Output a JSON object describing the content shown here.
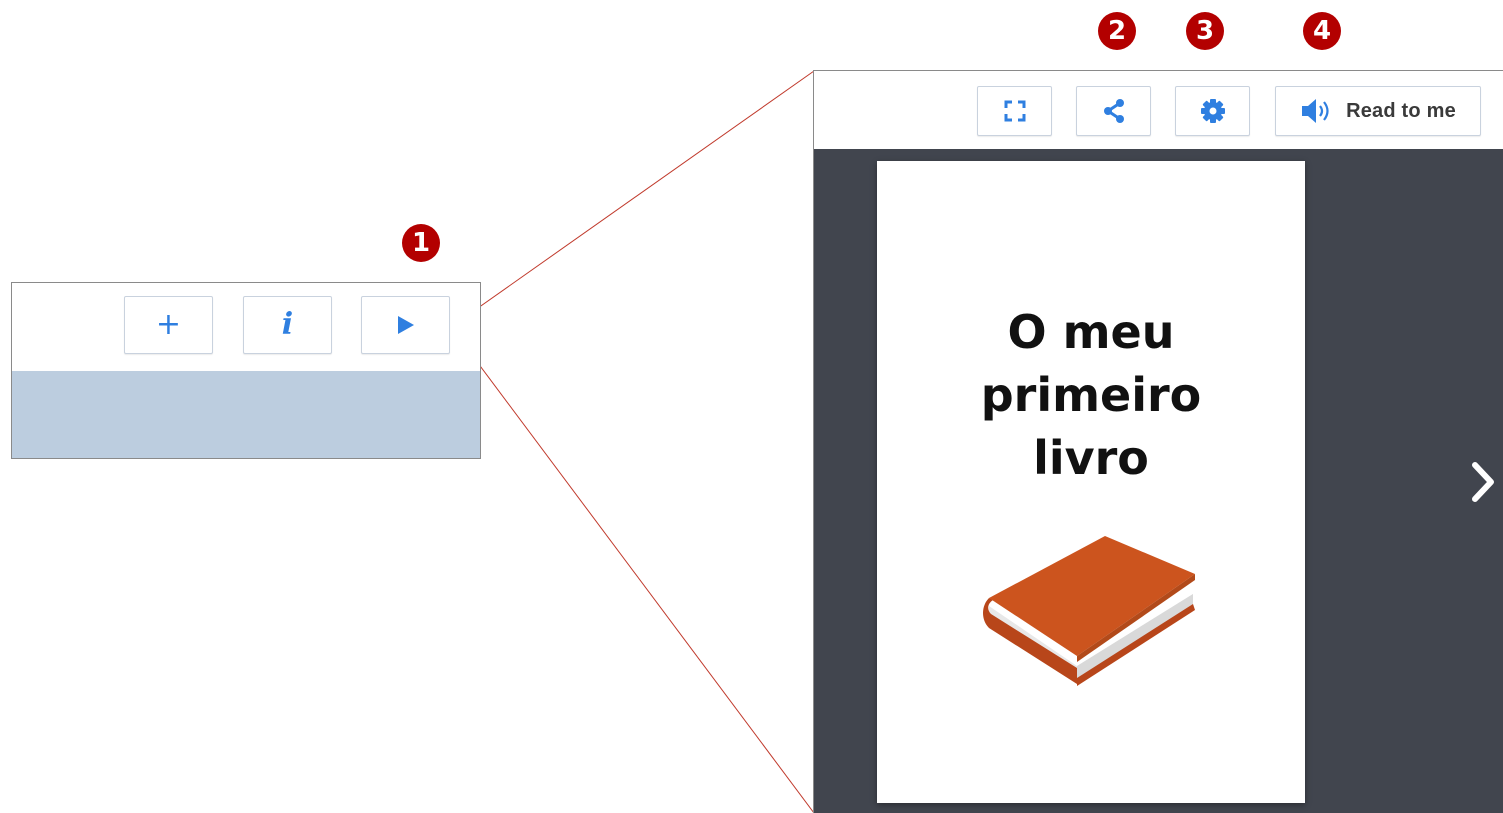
{
  "callouts": [
    "1",
    "2",
    "3",
    "4"
  ],
  "toolbar_small": {
    "buttons": [
      {
        "icon": "plus-icon",
        "label": "+"
      },
      {
        "icon": "info-icon",
        "label": "i"
      },
      {
        "icon": "play-icon"
      }
    ]
  },
  "toolbar_big": {
    "buttons": [
      {
        "icon": "fullscreen-icon"
      },
      {
        "icon": "share-icon"
      },
      {
        "icon": "settings-icon"
      },
      {
        "icon": "speaker-icon",
        "label": "Read to me"
      }
    ]
  },
  "book": {
    "title": "O meu\nprimeiro\nlivro",
    "illustration": "book-icon"
  },
  "viewer": {
    "next_icon": "chevron-right-icon"
  },
  "colors": {
    "accent": "#2f7fe0",
    "callout": "#b30000",
    "viewer_bg": "#41454e",
    "highlight_bar": "#bccddf",
    "zoom_line": "#c0392b",
    "book_cover": "#cc541e"
  }
}
